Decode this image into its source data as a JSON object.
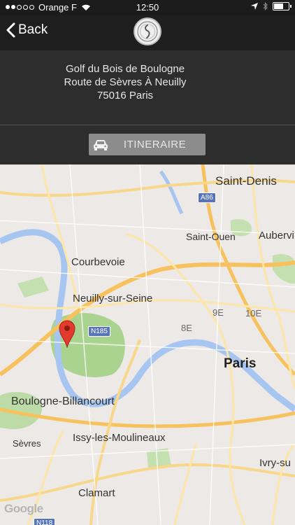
{
  "status_bar": {
    "carrier": "Orange F",
    "time": "12:50"
  },
  "nav": {
    "back_label": "Back"
  },
  "info": {
    "line1": "Golf du Bois de Boulogne",
    "line2": "Route de Sèvres À Neuilly",
    "line3": "75016 Paris"
  },
  "itinerary_button": {
    "label": "ITINERAIRE",
    "icon": "car-icon"
  },
  "map": {
    "labels": [
      "Saint-Denis",
      "Saint-Ouen",
      "Aubervi",
      "Courbevoie",
      "Neuilly-sur-Seine",
      "9E",
      "10E",
      "8E",
      "Paris",
      "Boulogne-Billancourt",
      "Sèvres",
      "Issy-les-Moulineaux",
      "Ivry-su",
      "Clamart"
    ],
    "road_badges": [
      "A86",
      "N185",
      "N118"
    ],
    "attribution": "Google",
    "marker_icon": "map-pin-icon"
  },
  "colors": {
    "bar": "#1e1e1e",
    "panel": "#2d2d2d",
    "button": "#8c8c8c",
    "pin": "#e23b2e"
  }
}
